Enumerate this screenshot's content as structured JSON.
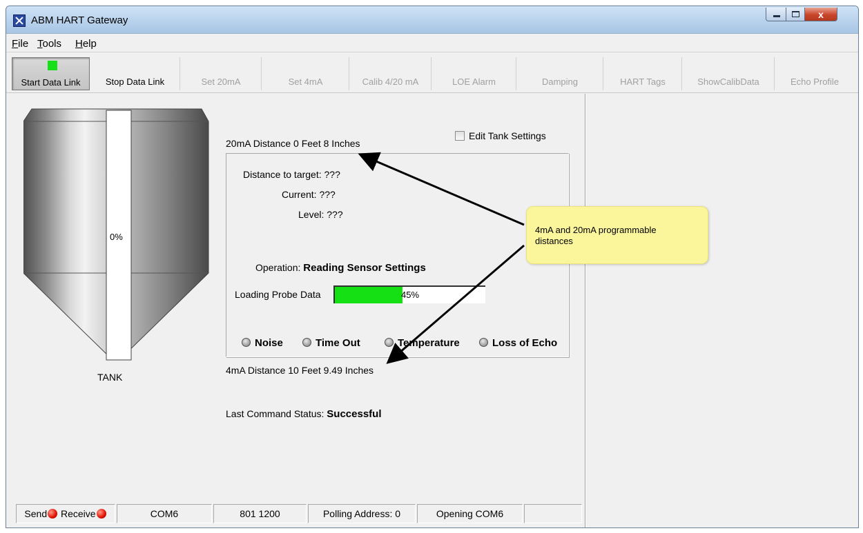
{
  "window": {
    "title": "ABM HART Gateway",
    "close_glyph": "x"
  },
  "menu": {
    "items": [
      "File",
      "Tools",
      "Help"
    ]
  },
  "toolbar": {
    "buttons": [
      "Start Data Link",
      "Stop Data Link",
      "Set 20mA",
      "Set 4mA",
      "Calib 4/20 mA",
      "LOE Alarm",
      "Damping",
      "HART Tags",
      "ShowCalibData",
      "Echo Profile"
    ],
    "link_indicator_color": "#18e018"
  },
  "tank": {
    "level_text": "0%",
    "label": "TANK",
    "level": 0
  },
  "settings": {
    "edit_tank_label": "Edit Tank Settings",
    "edit_tank_checked": false,
    "distance_20ma": "20mA Distance 0 Feet 8 Inches",
    "distance_4ma": "4mA Distance 10 Feet 9.49 Inches"
  },
  "readings": {
    "distance_label": "Distance to target:",
    "distance_value": "???",
    "current_label": "Current:",
    "current_value": "???",
    "level_label": "Level:",
    "level_value": "???"
  },
  "operation": {
    "label": "Operation:",
    "value": "Reading Sensor Settings"
  },
  "progress": {
    "label": "Loading Probe Data",
    "text": "45%",
    "value": 45
  },
  "indicators": [
    "Noise",
    "Time Out",
    "Temperature",
    "Loss of Echo"
  ],
  "last_command": {
    "label": "Last Command Status:",
    "value": "Successful"
  },
  "callout": {
    "text": "4mA and 20mA programmable distances"
  },
  "statusbar": {
    "send": "Send",
    "receive": "Receive",
    "port": "COM6",
    "settings": "801 1200",
    "polling": "Polling Address: 0",
    "status": "Opening COM6"
  },
  "colors": {
    "accent_green": "#14e014",
    "callout_bg": "#fbf59c",
    "led_red": "#e01000"
  }
}
